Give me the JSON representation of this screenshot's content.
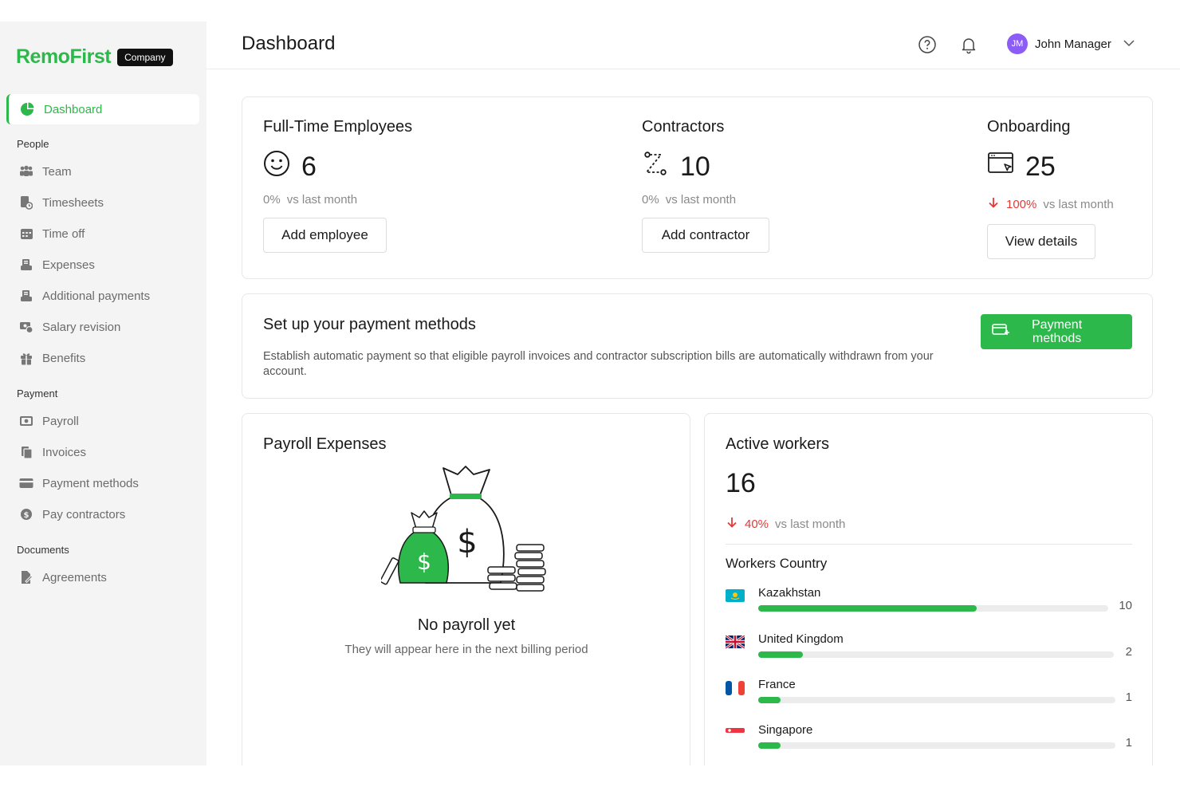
{
  "brand": {
    "logo": "RemoFirst",
    "badge": "Company"
  },
  "sidebar": {
    "active": {
      "label": "Dashboard",
      "icon": "pie-chart-icon"
    },
    "sections": [
      {
        "title": "People",
        "items": [
          {
            "label": "Team",
            "icon": "team-icon"
          },
          {
            "label": "Timesheets",
            "icon": "timesheet-icon"
          },
          {
            "label": "Time off",
            "icon": "calendar-icon"
          },
          {
            "label": "Expenses",
            "icon": "expenses-icon"
          },
          {
            "label": "Additional payments",
            "icon": "payments-icon"
          },
          {
            "label": "Salary revision",
            "icon": "salary-icon"
          },
          {
            "label": "Benefits",
            "icon": "gift-icon"
          }
        ]
      },
      {
        "title": "Payment",
        "items": [
          {
            "label": "Payroll",
            "icon": "cash-icon"
          },
          {
            "label": "Invoices",
            "icon": "invoice-icon"
          },
          {
            "label": "Payment methods",
            "icon": "card-icon"
          },
          {
            "label": "Pay contractors",
            "icon": "dollar-icon"
          }
        ]
      },
      {
        "title": "Documents",
        "items": [
          {
            "label": "Agreements",
            "icon": "document-sign-icon"
          }
        ]
      }
    ]
  },
  "header": {
    "title": "Dashboard",
    "user": {
      "initials": "JM",
      "name": "John Manager"
    }
  },
  "stats": {
    "fte": {
      "title": "Full-Time Employees",
      "value": "6",
      "pct": "0%",
      "suffix": "vs last month",
      "button": "Add employee"
    },
    "contractors": {
      "title": "Contractors",
      "value": "10",
      "pct": "0%",
      "suffix": "vs last month",
      "button": "Add contractor"
    },
    "onboarding": {
      "title": "Onboarding",
      "value": "25",
      "pct": "100%",
      "suffix": "vs last month",
      "button": "View details"
    }
  },
  "payment_setup": {
    "title": "Set up your payment methods",
    "description": "Establish automatic payment so that eligible payroll invoices and contractor subscription bills are automatically withdrawn from your account.",
    "button_line1": "Payment",
    "button_line2": "methods"
  },
  "payroll": {
    "title": "Payroll Expenses",
    "empty_title": "No payroll yet",
    "empty_sub": "They will appear here in the next billing period"
  },
  "active_workers": {
    "title": "Active workers",
    "value": "16",
    "pct": "40%",
    "suffix": "vs last month",
    "countries_title": "Workers Country",
    "countries": [
      {
        "name": "Kazakhstan",
        "count": "10",
        "share": 0.625
      },
      {
        "name": "United Kingdom",
        "count": "2",
        "share": 0.125
      },
      {
        "name": "France",
        "count": "1",
        "share": 0.0625
      },
      {
        "name": "Singapore",
        "count": "1",
        "share": 0.0625
      }
    ]
  },
  "colors": {
    "brand_green": "#2db84b",
    "negative_red": "#e53935",
    "avatar_purple": "#8b5cf6"
  }
}
